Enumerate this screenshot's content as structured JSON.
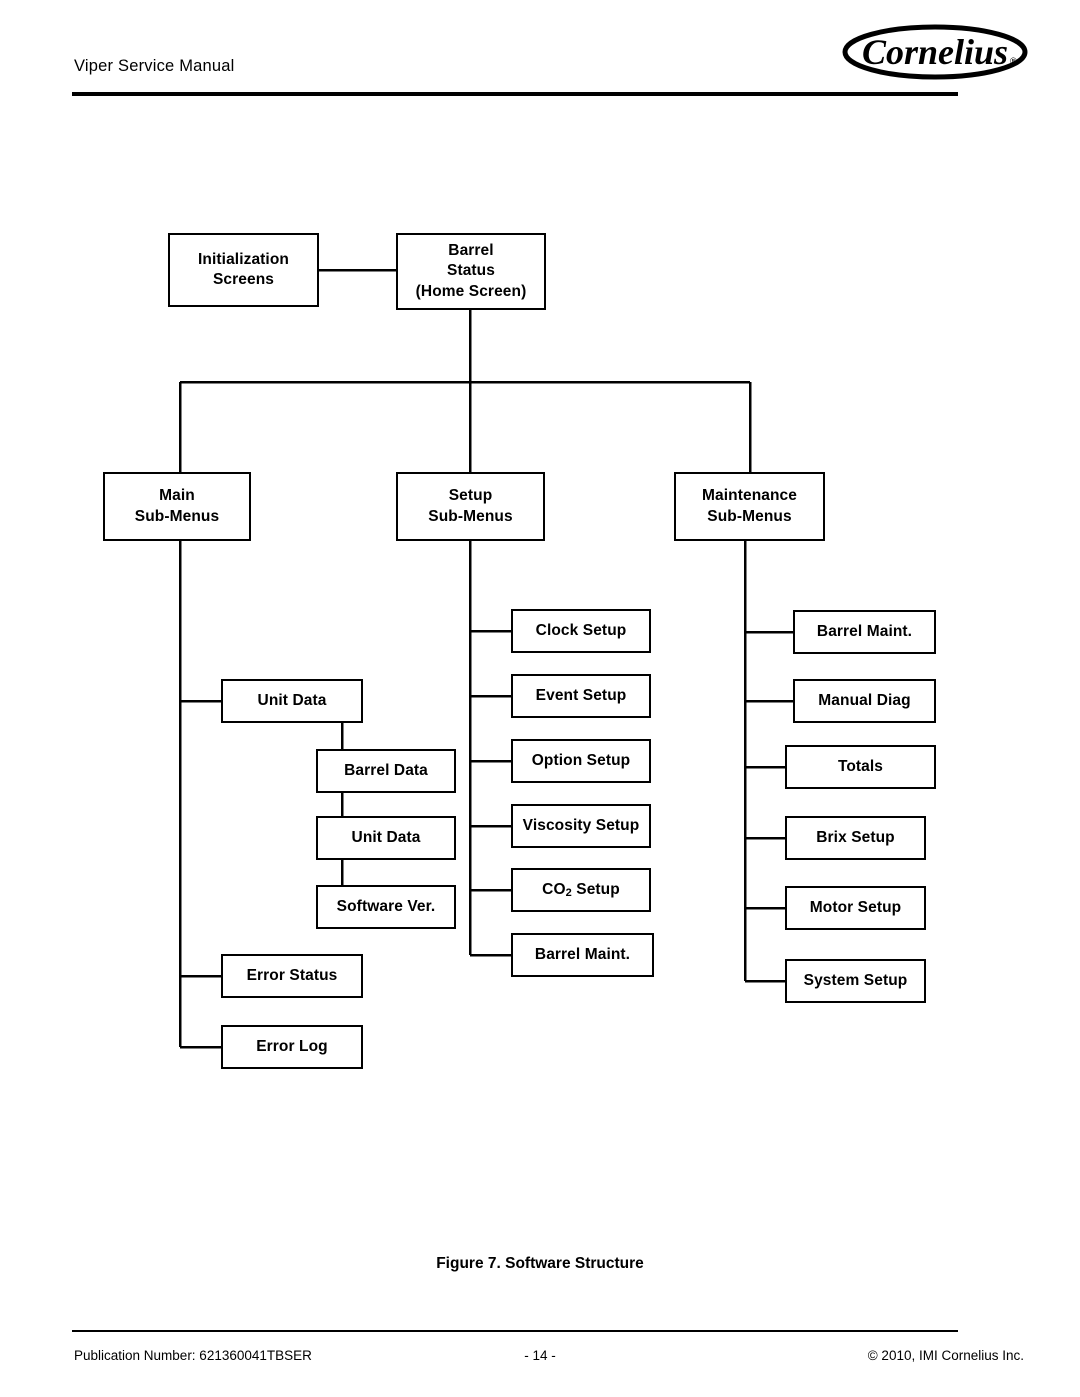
{
  "header": {
    "title": "Viper Service Manual",
    "logo_text": "Cornelius",
    "logo_mark": "registered-trademark"
  },
  "figure": {
    "caption": "Figure 7. Software Structure"
  },
  "footer": {
    "publication_label": "Publication Number: 621360041TBSER",
    "page_number": "- 14 -",
    "copyright": "© 2010, IMI Cornelius Inc."
  },
  "diagram": {
    "title": "Software Structure",
    "type": "tree",
    "nodes": {
      "initialization": {
        "line1": "Initialization",
        "line2": "Screens"
      },
      "home": {
        "line1": "Barrel",
        "line2": "Status",
        "line3": "(Home Screen)"
      },
      "main_submenus": {
        "line1": "Main",
        "line2": "Sub-Menus"
      },
      "setup_submenus": {
        "line1": "Setup",
        "line2": "Sub-Menus"
      },
      "maintenance_submenus": {
        "line1": "Maintenance",
        "line2": "Sub-Menus"
      }
    },
    "main_items": [
      {
        "label": "Unit Data"
      },
      {
        "label": "Error Status"
      },
      {
        "label": "Error Log"
      }
    ],
    "unit_data_children": [
      {
        "label": "Barrel Data"
      },
      {
        "label": "Unit Data"
      },
      {
        "label": "Software Ver."
      }
    ],
    "setup_items": [
      {
        "label": "Clock Setup"
      },
      {
        "label": "Event Setup"
      },
      {
        "label": "Option Setup"
      },
      {
        "label": "Viscosity Setup"
      },
      {
        "label": "CO2 Setup",
        "text": "CO",
        "sub": "2",
        "suffix": " Setup"
      },
      {
        "label": "Barrel Maint."
      }
    ],
    "maintenance_items": [
      {
        "label": "Barrel Maint."
      },
      {
        "label": "Manual Diag"
      },
      {
        "label": "Totals"
      },
      {
        "label": "Brix Setup"
      },
      {
        "label": "Motor Setup"
      },
      {
        "label": "System Setup"
      }
    ],
    "colors": {
      "stroke": "#000000",
      "fill": "#ffffff",
      "text": "#000000"
    }
  }
}
